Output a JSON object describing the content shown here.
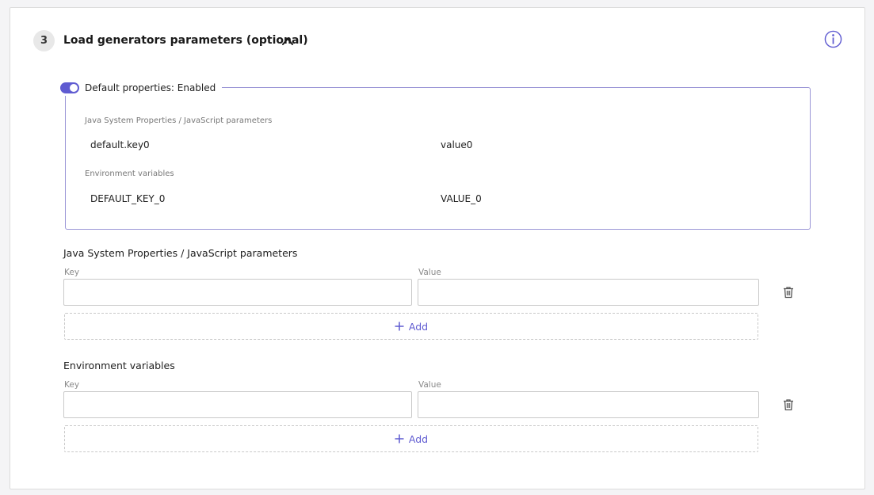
{
  "section": {
    "step_number": "3",
    "title": "Load generators parameters (optional)"
  },
  "defaults": {
    "toggle_label": "Default properties: Enabled",
    "toggle_on": true,
    "java_caption": "Java System Properties / JavaScript parameters",
    "java_items": [
      {
        "key": "default.key0",
        "value": "value0"
      }
    ],
    "env_caption": "Environment variables",
    "env_items": [
      {
        "key": "DEFAULT_KEY_0",
        "value": "VALUE_0"
      }
    ]
  },
  "java_params": {
    "title": "Java System Properties / JavaScript parameters",
    "key_label": "Key",
    "value_label": "Value",
    "key_value": "",
    "value_value": "",
    "add_label": "Add"
  },
  "env_vars": {
    "title": "Environment variables",
    "key_label": "Key",
    "value_label": "Value",
    "key_value": "",
    "value_value": "",
    "add_label": "Add"
  },
  "colors": {
    "accent": "#5f5bd1",
    "border_accent": "#9b96d6"
  },
  "icons": [
    "chevron-up-icon",
    "info-icon",
    "trash-icon",
    "plus-icon"
  ]
}
